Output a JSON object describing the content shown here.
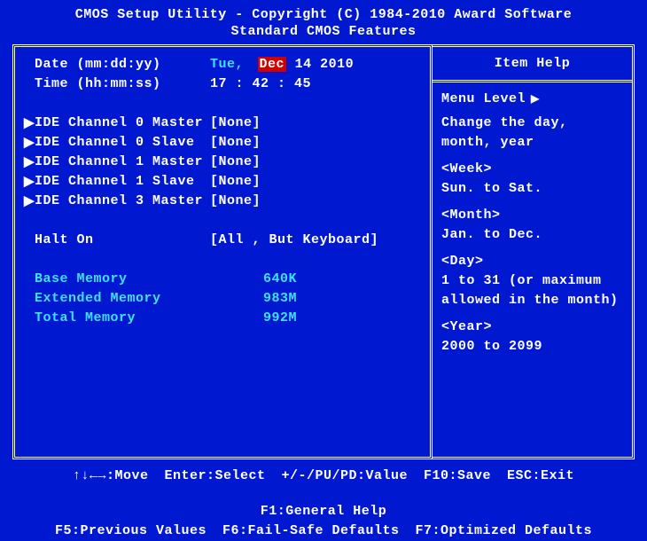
{
  "title": "CMOS Setup Utility - Copyright (C) 1984-2010 Award Software",
  "subtitle": "Standard CMOS Features",
  "fields": {
    "date_label": "Date (mm:dd:yy)",
    "date_weekday": "Tue,",
    "date_month": "Dec",
    "date_day": "14",
    "date_year": "2010",
    "time_label": "Time (hh:mm:ss)",
    "time_value": "17 : 42 : 45",
    "haltOn_label": "Halt On",
    "haltOn_value": "[All , But Keyboard]"
  },
  "ide": [
    {
      "label": "IDE Channel 0 Master",
      "value": "[None]"
    },
    {
      "label": "IDE Channel 0 Slave",
      "value": "[None]"
    },
    {
      "label": "IDE Channel 1 Master",
      "value": "[None]"
    },
    {
      "label": "IDE Channel 1 Slave",
      "value": "[None]"
    },
    {
      "label": "IDE Channel 3 Master",
      "value": "[None]"
    }
  ],
  "memory": {
    "base_label": "Base Memory",
    "base_value": "640K",
    "ext_label": "Extended Memory",
    "ext_value": "983M",
    "total_label": "Total Memory",
    "total_value": "992M"
  },
  "help": {
    "title": "Item Help",
    "menuLevel": "Menu Level",
    "desc": "Change the day, month, year",
    "week_h": "<Week>",
    "week_t": "Sun. to Sat.",
    "month_h": "<Month>",
    "month_t": "Jan. to Dec.",
    "day_h": "<Day>",
    "day_t": "1 to 31 (or maximum allowed in the month)",
    "year_h": "<Year>",
    "year_t": "2000 to 2099"
  },
  "footer": {
    "move": "↑↓←→:Move",
    "enter": "Enter:Select",
    "value": "+/-/PU/PD:Value",
    "save": "F10:Save",
    "exit": "ESC:Exit",
    "help": "F1:General Help",
    "prev": "F5:Previous Values",
    "failsafe": "F6:Fail-Safe Defaults",
    "opt": "F7:Optimized Defaults"
  }
}
